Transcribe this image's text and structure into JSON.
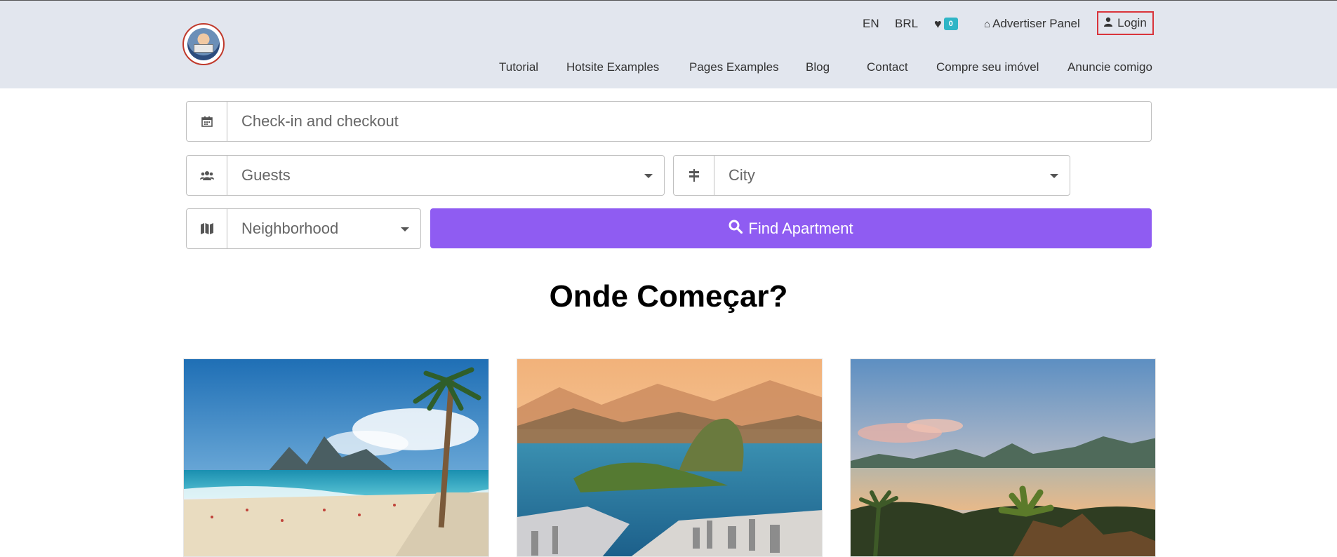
{
  "header": {
    "language": "EN",
    "currency": "BRL",
    "favorites_count": "0",
    "advertiser_panel": "Advertiser Panel",
    "login": "Login"
  },
  "nav": {
    "items": [
      "Tutorial",
      "Hotsite Examples",
      "Pages Examples",
      "Blog",
      "Contact",
      "Compre seu imóvel",
      "Anuncie comigo"
    ]
  },
  "search": {
    "dates_placeholder": "Check-in and checkout",
    "guests_placeholder": "Guests",
    "city_placeholder": "City",
    "neighborhood_placeholder": "Neighborhood",
    "find_button": "Find Apartment"
  },
  "section": {
    "title": "Onde Começar?"
  },
  "colors": {
    "accent": "#8f5cf2",
    "badge": "#2fb5c6",
    "login_highlight": "#d9343b",
    "header_bg": "#e2e6ee"
  },
  "icons": {
    "favorites": "heart-icon",
    "advertiser": "home-icon",
    "login": "user-icon",
    "dates": "calendar-icon",
    "guests": "users-icon",
    "city": "signpost-icon",
    "neighborhood": "map-icon",
    "find": "search-icon"
  }
}
